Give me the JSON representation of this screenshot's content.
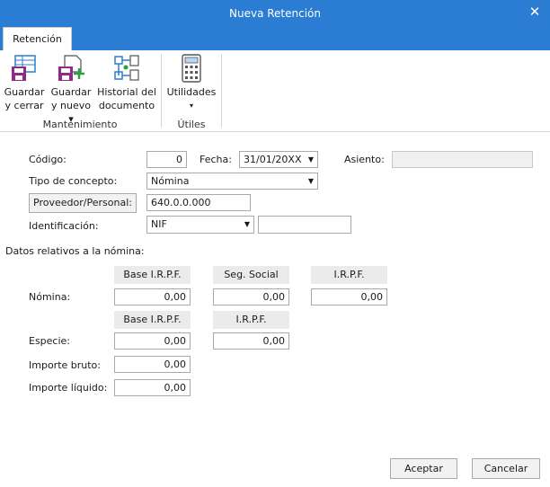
{
  "window": {
    "title": "Nueva Retención",
    "close_glyph": "✕"
  },
  "ribbon": {
    "tab": "Retención",
    "buttons": {
      "save_close": [
        "Guardar",
        "y cerrar"
      ],
      "save_new": [
        "Guardar",
        "y nuevo ▾"
      ],
      "history": [
        "Historial del",
        "documento"
      ],
      "utilities": [
        "Utilidades",
        "▾"
      ]
    },
    "groups": {
      "maintenance": "Mantenimiento",
      "utils": "Útiles"
    },
    "icons": [
      "floppy-grid-icon",
      "floppy-plus-icon",
      "document-tree-icon",
      "calculator-icon"
    ]
  },
  "form": {
    "codigo_label": "Código:",
    "codigo_value": "0",
    "fecha_label": "Fecha:",
    "fecha_value": "31/01/20XX",
    "asiento_label": "Asiento:",
    "asiento_value": "",
    "tipo_label": "Tipo de concepto:",
    "tipo_value": "Nómina",
    "proveedor_button": "Proveedor/Personal:",
    "proveedor_value": "640.0.0.000",
    "identificacion_label": "Identificación:",
    "identificacion_type": "NIF",
    "identificacion_value": ""
  },
  "nomina": {
    "section_title": "Datos relativos a la nómina:",
    "nomina_headers": [
      "Base I.R.P.F.",
      "Seg. Social",
      "I.R.P.F."
    ],
    "nomina_label": "Nómina:",
    "nomina_values": [
      "0,00",
      "0,00",
      "0,00"
    ],
    "especie_headers": [
      "Base I.R.P.F.",
      "I.R.P.F."
    ],
    "especie_label": "Especie:",
    "especie_values": [
      "0,00",
      "0,00"
    ],
    "bruto_label": "Importe bruto:",
    "bruto_value": "0,00",
    "liquido_label": "Importe líquido:",
    "liquido_value": "0,00"
  },
  "footer": {
    "accept": "Aceptar",
    "cancel": "Cancelar"
  }
}
